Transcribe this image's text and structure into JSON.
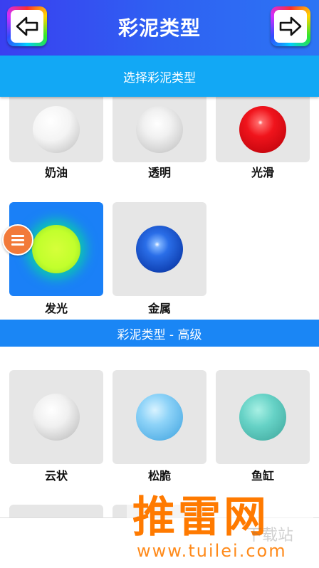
{
  "header": {
    "title": "彩泥类型",
    "back_icon": "arrow-left-icon",
    "forward_icon": "arrow-right-icon"
  },
  "subtitle": "选择彩泥类型",
  "basic_types": [
    {
      "label": "奶油",
      "selected": false,
      "color": "#ffffff"
    },
    {
      "label": "透明",
      "selected": false,
      "color": "#e8e8e8"
    },
    {
      "label": "光滑",
      "selected": false,
      "color": "#e8121a"
    },
    {
      "label": "发光",
      "selected": true,
      "color": "#c4ff2a"
    },
    {
      "label": "金属",
      "selected": false,
      "color": "#1a5ed8"
    }
  ],
  "advanced_section_title": "彩泥类型 - 高级",
  "advanced_types": [
    {
      "label": "云状",
      "color": "#f2f2f2"
    },
    {
      "label": "松脆",
      "color": "#7cc8f2"
    },
    {
      "label": "鱼缸",
      "color": "#5cccc0"
    }
  ],
  "menu_icon": "menu-icon",
  "watermark": {
    "main": "推雷网",
    "url": "www.tuilei.com",
    "overlay": "下载站"
  }
}
